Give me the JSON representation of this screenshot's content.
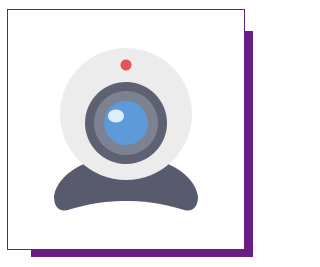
{
  "image": {
    "subject": "webcam-icon",
    "colors": {
      "frame_accent": "#6a1c85",
      "card_background": "#ffffff",
      "webcam_body": "#ececec",
      "lens_ring_outer": "#5d6171",
      "lens_ring_inner": "#7d8292",
      "lens_glass": "#5c9ad9",
      "lens_highlight": "#e6f1fb",
      "indicator_light": "#e8505b",
      "stand": "#575b6d"
    }
  }
}
